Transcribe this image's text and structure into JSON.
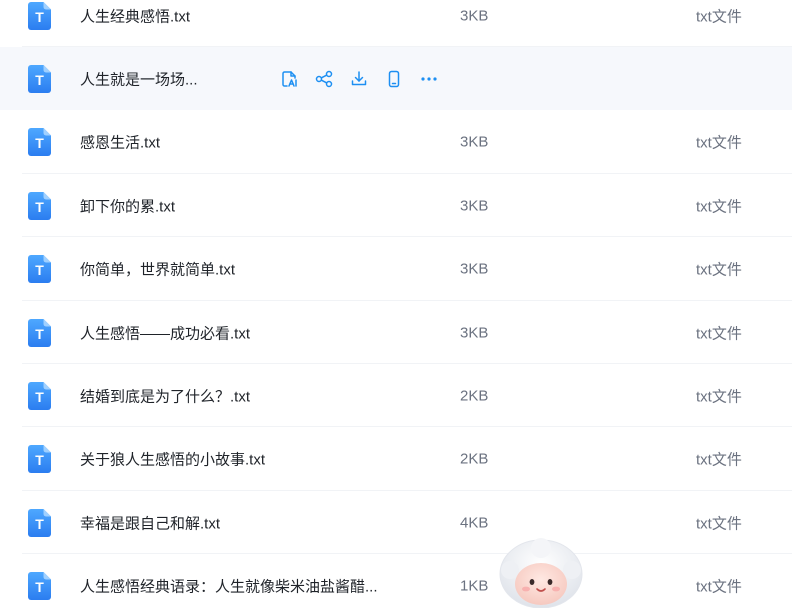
{
  "colors": {
    "accent": "#1d8ff2",
    "row_hover": "#f6f8fc",
    "divider": "#f1f3f6"
  },
  "hover_actions": [
    {
      "name": "ai-read-icon"
    },
    {
      "name": "share-icon"
    },
    {
      "name": "download-icon"
    },
    {
      "name": "phone-icon"
    },
    {
      "name": "more-icon"
    }
  ],
  "files": [
    {
      "icon": "txt-file-icon",
      "icon_letter": "T",
      "name": "人生经典感悟.txt",
      "size": "3KB",
      "type": "txt文件"
    },
    {
      "icon": "txt-file-icon",
      "icon_letter": "T",
      "name": "人生就是一场场...",
      "size": "",
      "type": "",
      "hovered": true
    },
    {
      "icon": "txt-file-icon",
      "icon_letter": "T",
      "name": "感恩生活.txt",
      "size": "3KB",
      "type": "txt文件"
    },
    {
      "icon": "txt-file-icon",
      "icon_letter": "T",
      "name": "卸下你的累.txt",
      "size": "3KB",
      "type": "txt文件"
    },
    {
      "icon": "txt-file-icon",
      "icon_letter": "T",
      "name": "你简单，世界就简单.txt",
      "size": "3KB",
      "type": "txt文件"
    },
    {
      "icon": "txt-file-icon",
      "icon_letter": "T",
      "name": "人生感悟——成功必看.txt",
      "size": "3KB",
      "type": "txt文件"
    },
    {
      "icon": "txt-file-icon",
      "icon_letter": "T",
      "name": "结婚到底是为了什么？.txt",
      "size": "2KB",
      "type": "txt文件"
    },
    {
      "icon": "txt-file-icon",
      "icon_letter": "T",
      "name": "关于狼人生感悟的小故事.txt",
      "size": "2KB",
      "type": "txt文件"
    },
    {
      "icon": "txt-file-icon",
      "icon_letter": "T",
      "name": "幸福是跟自己和解.txt",
      "size": "4KB",
      "type": "txt文件"
    },
    {
      "icon": "txt-file-icon",
      "icon_letter": "T",
      "name": "人生感悟经典语录：人生就像柴米油盐酱醋...",
      "size": "1KB",
      "type": "txt文件"
    }
  ],
  "mascot": {
    "icon": "assistant-mascot-icon"
  }
}
